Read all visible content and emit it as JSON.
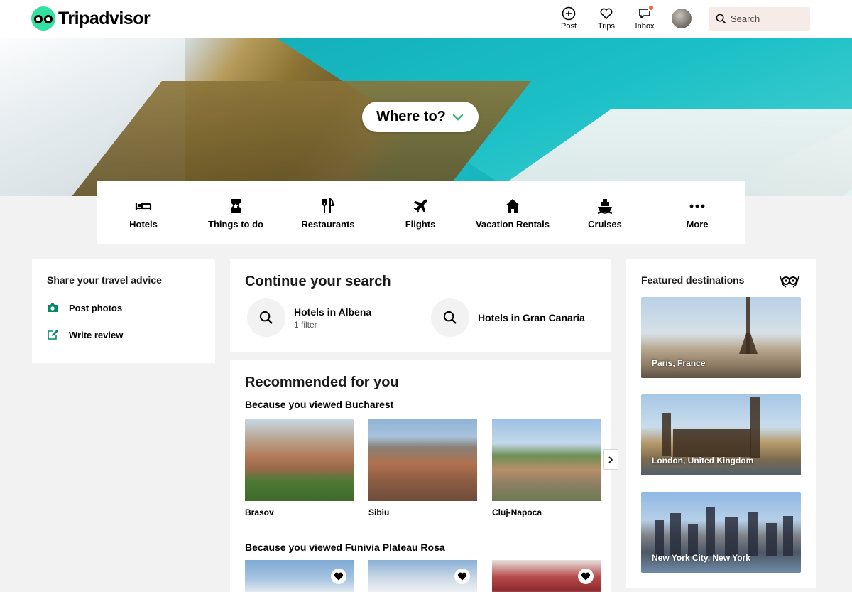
{
  "header": {
    "brand": "Tripadvisor",
    "nav": {
      "post": "Post",
      "trips": "Trips",
      "inbox": "Inbox"
    },
    "search_placeholder": "Search"
  },
  "hero": {
    "where_to": "Where to?"
  },
  "categories": [
    {
      "label": "Hotels",
      "icon": "bed-icon"
    },
    {
      "label": "Things to do",
      "icon": "ticket-icon"
    },
    {
      "label": "Restaurants",
      "icon": "fork-knife-icon"
    },
    {
      "label": "Flights",
      "icon": "plane-icon"
    },
    {
      "label": "Vacation Rentals",
      "icon": "house-icon"
    },
    {
      "label": "Cruises",
      "icon": "ship-icon"
    },
    {
      "label": "More",
      "icon": "more-dots-icon"
    }
  ],
  "share": {
    "title": "Share your travel advice",
    "post_photos": "Post photos",
    "write_review": "Write review"
  },
  "continue": {
    "title": "Continue your search",
    "items": [
      {
        "title": "Hotels in Albena",
        "subtitle": "1 filter"
      },
      {
        "title": "Hotels in Gran Canaria"
      }
    ]
  },
  "recommended": {
    "title": "Recommended for you",
    "group1": {
      "heading": "Because you viewed Bucharest",
      "items": [
        "Brasov",
        "Sibiu",
        "Cluj-Napoca"
      ]
    },
    "group2": {
      "heading": "Because you viewed Funivia Plateau Rosa"
    }
  },
  "featured": {
    "title": "Featured destinations",
    "destinations": [
      "Paris, France",
      "London, United Kingdom",
      "New York City, New York"
    ]
  },
  "colors": {
    "brand_green": "#34e0a1",
    "badge": "#f2643d",
    "search_bg": "#f6ebe6"
  }
}
